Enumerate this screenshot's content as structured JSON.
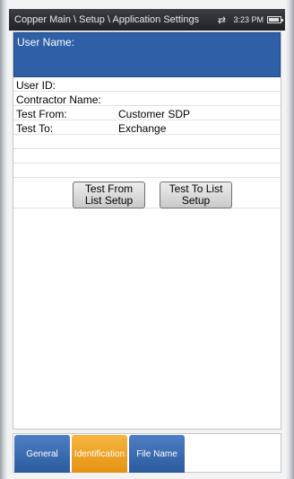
{
  "titlebar": {
    "path": "Copper Main \\ Setup \\ Application Settings",
    "time": "3:23 PM",
    "connection_icon": "swap-arrows-icon",
    "battery_icon": "battery-icon"
  },
  "form": {
    "username_label": "User Name:",
    "fields": [
      {
        "label": "User ID:",
        "value": ""
      },
      {
        "label": "Contractor Name:",
        "value": ""
      },
      {
        "label": "Test From:",
        "value": "Customer SDP"
      },
      {
        "label": "Test To:",
        "value": "Exchange"
      }
    ]
  },
  "buttons": {
    "test_from": "Test From List Setup",
    "test_to": "Test To List Setup"
  },
  "tabs": [
    {
      "label": "General",
      "active": false
    },
    {
      "label": "Identification",
      "active": true
    },
    {
      "label": "File Name",
      "active": false
    }
  ],
  "colors": {
    "accent_blue": "#2f5fa6",
    "active_tab": "#f0a020",
    "titlebar": "#2a2d31"
  }
}
